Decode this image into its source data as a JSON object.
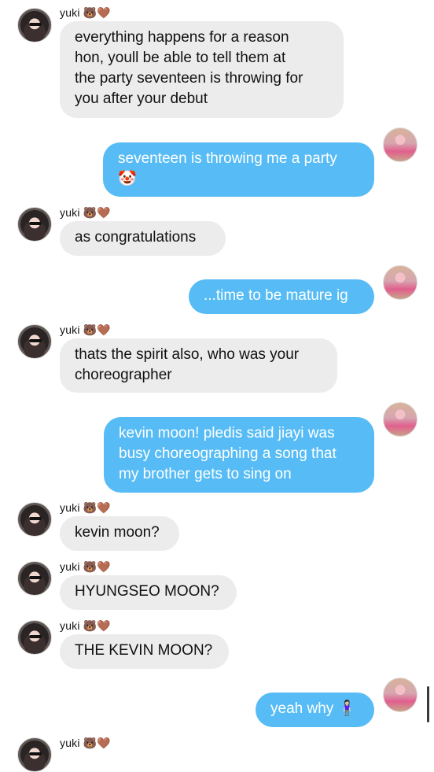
{
  "messages": [
    {
      "sender": "yuki",
      "name": "yuki",
      "name_emoji": "🐻🤎",
      "text": "everything happens for a reason\nhon, youll be able to tell them at\nthe party seventeen is throwing for\nyou after your debut"
    },
    {
      "sender": "me",
      "text": "seventeen is throwing me a party\n🤡"
    },
    {
      "sender": "yuki",
      "name": "yuki",
      "name_emoji": "🐻🤎",
      "text": "as congratulations"
    },
    {
      "sender": "me",
      "text": "...time to be mature ig"
    },
    {
      "sender": "yuki",
      "name": "yuki",
      "name_emoji": "🐻🤎",
      "text": "thats the spirit also, who was your\nchoreographer"
    },
    {
      "sender": "me",
      "text": "kevin moon! pledis said jiayi was\nbusy choreographing a song that\nmy brother gets to sing on"
    },
    {
      "sender": "yuki",
      "name": "yuki",
      "name_emoji": "🐻🤎",
      "text": "kevin moon?"
    },
    {
      "sender": "yuki",
      "name": "yuki",
      "name_emoji": "🐻🤎",
      "text": "HYUNGSEO MOON?"
    },
    {
      "sender": "yuki",
      "name": "yuki",
      "name_emoji": "🐻🤎",
      "text": "THE KEVIN MOON?"
    },
    {
      "sender": "me",
      "text": "yeah why 🧍🏻‍♀️"
    },
    {
      "sender": "yuki",
      "name": "yuki",
      "name_emoji": "🐻🤎"
    }
  ],
  "colors": {
    "incoming_bubble": "#ececec",
    "outgoing_bubble": "#57bcf5",
    "outgoing_text": "#ffffff"
  },
  "icons": {
    "them_avatar": "avatar-yuki",
    "me_avatar": "avatar-me"
  }
}
